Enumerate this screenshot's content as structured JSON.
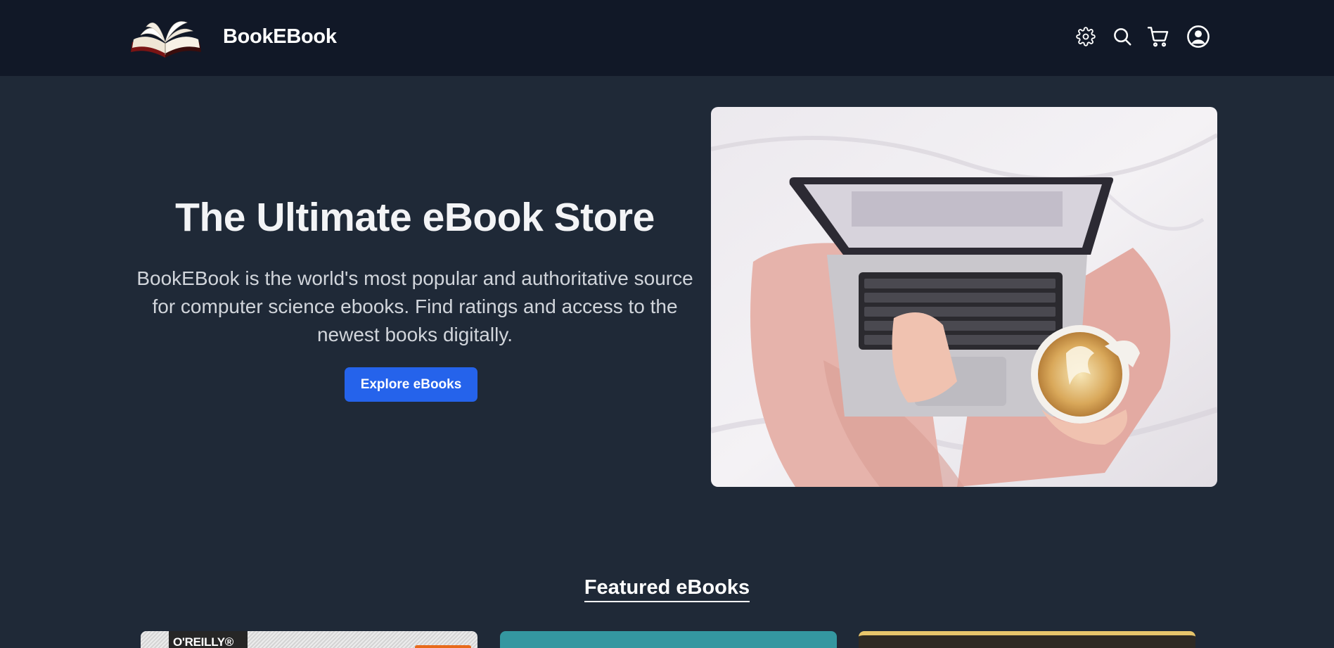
{
  "nav": {
    "brand": "BookEBook",
    "icons": [
      "book-logo",
      "gear-icon",
      "search-icon",
      "cart-icon",
      "user-account-icon"
    ]
  },
  "hero": {
    "title": "The Ultimate eBook Store",
    "description": "BookEBook is the world's most popular and authoritative source for computer science ebooks. Find ratings and access to the newest books digitally.",
    "cta_label": "Explore eBooks"
  },
  "featured": {
    "heading": "Featured eBooks",
    "cards": [
      {
        "publisher_badge": "O'REILLY®"
      },
      {
        "publisher_badge": ""
      },
      {
        "publisher_badge": ""
      }
    ]
  },
  "colors": {
    "navbar_bg": "#111827",
    "page_bg": "#1f2937",
    "accent_button": "#2563eb",
    "text_primary": "#f3f4f6",
    "text_secondary": "#d1d5db"
  }
}
